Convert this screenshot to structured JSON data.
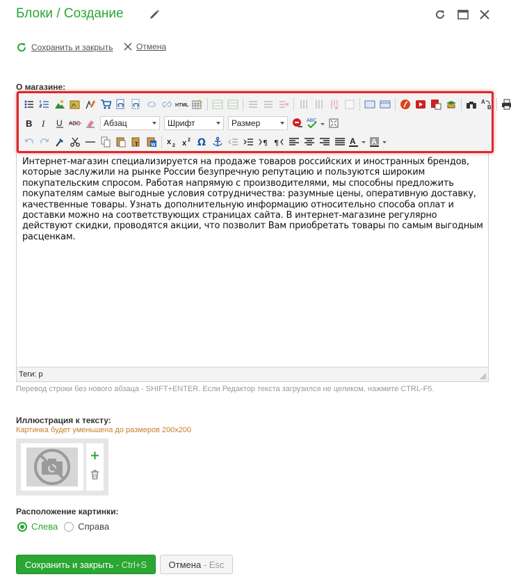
{
  "header": {
    "title": "Блоки / Создание"
  },
  "actions": {
    "save_close": "Сохранить и закрыть",
    "cancel": "Отмена"
  },
  "editor": {
    "label": "О магазине:",
    "paragraph_style": "Абзац",
    "font": "Шрифт",
    "size": "Размер",
    "content": "Интернет-магазин специализируется на продаже товаров российских и иностранных брендов, которые заслужили на рынке России безупречную репутацию и пользуются широким покупательским спросом. Работая напрямую с производителями, мы способны предложить покупателям самые выгодные условия сотрудничества: разумные цены, оперативную доставку, качественные товары. Узнать дополнительную информацию относительно способа оплат и доставки можно на соответствующих страницах сайта. В интернет-магазине регулярно действуют скидки, проводятся акции, что позволит Вам приобретать товары по самым выгодным расценкам.",
    "tags": "Теги: p",
    "hint": "Перевод строки без нового абзаца - SHIFT+ENTER. Если Редактор текста загрузился не целиком, нажмите CTRL-F5."
  },
  "illustration": {
    "label": "Иллюстрация к тексту:",
    "note": "Картинка будет уменьшена до размеров 200x200"
  },
  "position": {
    "label": "Расположение картинки:",
    "options": [
      "Слева",
      "Справа"
    ],
    "selected": "Слева"
  },
  "footer": {
    "save_label": "Сохранить и закрыть",
    "save_shortcut": "Ctrl+S",
    "cancel_label": "Отмена",
    "cancel_shortcut": "Esc",
    "separator": " - "
  },
  "colors": {
    "accent": "#2aa632",
    "highlight_frame": "#e0262b",
    "note": "#c97d2b"
  }
}
